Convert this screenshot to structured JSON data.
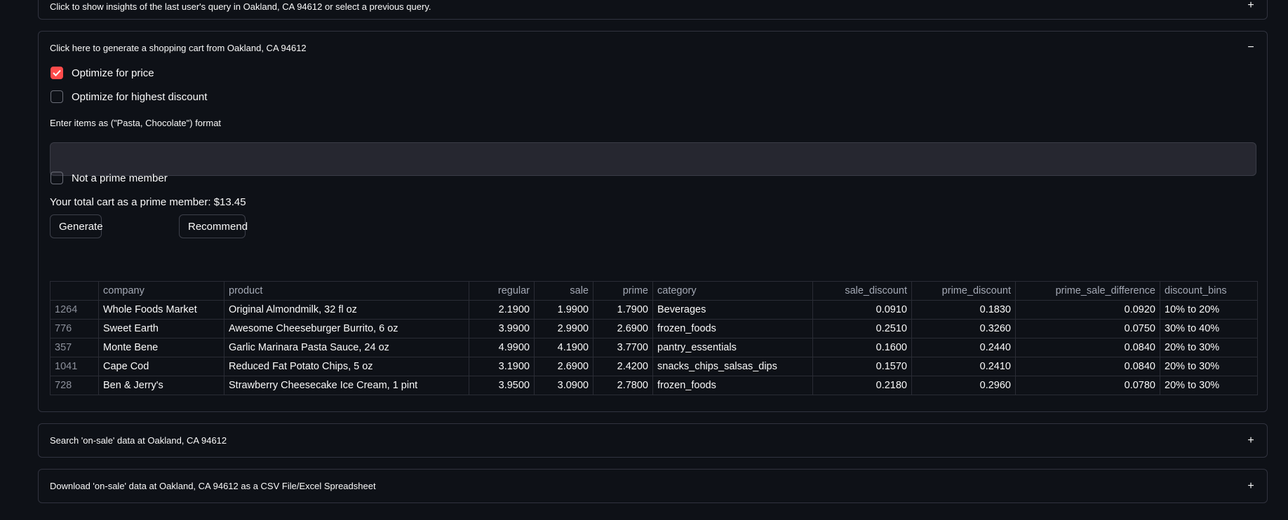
{
  "insights": {
    "label": "Click to show insights of the last user's query in Oakland, CA 94612 or select a previous query.",
    "icon": "+"
  },
  "cart": {
    "label": "Click here to generate a shopping cart from Oakland, CA 94612",
    "icon": "−",
    "optimize_price": {
      "label": "Optimize for price",
      "checked": true
    },
    "optimize_discount": {
      "label": "Optimize for highest discount",
      "checked": false
    },
    "items_label": "Enter items as (\"Pasta, Chocolate\") format",
    "items_value": "",
    "not_prime": {
      "label": "Not a prime member",
      "checked": false
    },
    "total_text": "Your total cart as a prime member: $13.45",
    "generate_label": "Generate",
    "recommend_label": "Recommend",
    "accent": "#ff4b4b",
    "table": {
      "columns": [
        "",
        "company",
        "product",
        "regular",
        "sale",
        "prime",
        "category",
        "sale_discount",
        "prime_discount",
        "prime_sale_difference",
        "discount_bins"
      ],
      "rows": [
        [
          "1264",
          "Whole Foods Market",
          "Original Almondmilk, 32 fl oz",
          "2.1900",
          "1.9900",
          "1.7900",
          "Beverages",
          "0.0910",
          "0.1830",
          "0.0920",
          "10% to 20%"
        ],
        [
          "776",
          "Sweet Earth",
          "Awesome Cheeseburger Burrito, 6 oz",
          "3.9900",
          "2.9900",
          "2.6900",
          "frozen_foods",
          "0.2510",
          "0.3260",
          "0.0750",
          "30% to 40%"
        ],
        [
          "357",
          "Monte Bene",
          "Garlic Marinara Pasta Sauce, 24 oz",
          "4.9900",
          "4.1900",
          "3.7700",
          "pantry_essentials",
          "0.1600",
          "0.2440",
          "0.0840",
          "20% to 30%"
        ],
        [
          "1041",
          "Cape Cod",
          "Reduced Fat Potato Chips, 5 oz",
          "3.1900",
          "2.6900",
          "2.4200",
          "snacks_chips_salsas_dips",
          "0.1570",
          "0.2410",
          "0.0840",
          "20% to 30%"
        ],
        [
          "728",
          "Ben & Jerry's",
          "Strawberry Cheesecake Ice Cream, 1 pint",
          "3.9500",
          "3.0900",
          "2.7800",
          "frozen_foods",
          "0.2180",
          "0.2960",
          "0.0780",
          "20% to 30%"
        ]
      ]
    }
  },
  "search": {
    "label": "Search 'on-sale' data at Oakland, CA 94612",
    "icon": "+"
  },
  "download": {
    "label": "Download 'on-sale' data at Oakland, CA 94612 as a CSV File/Excel Spreadsheet",
    "icon": "+"
  }
}
